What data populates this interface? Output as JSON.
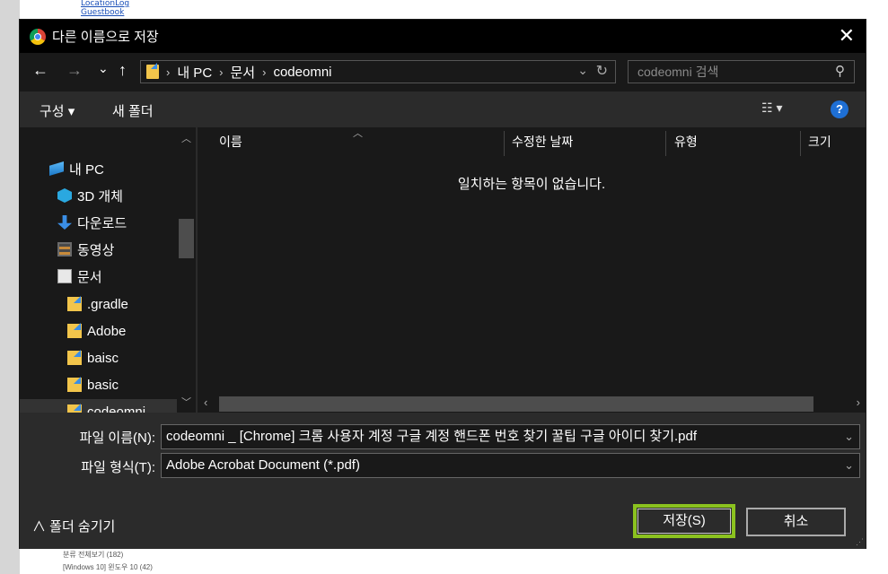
{
  "background_page": {
    "links": [
      "LocationLog",
      "Guestbook"
    ],
    "bottom_lines": [
      "분류 전체보기 (182)",
      "[Windows 10] 윈도우 10 (42)"
    ]
  },
  "dialog": {
    "title": "다른 이름으로 저장",
    "close_symbol": "✕",
    "nav": {
      "back_symbol": "←",
      "forward_symbol": "→",
      "recent_symbol": "⌄",
      "up_symbol": "↑"
    },
    "breadcrumb": [
      "내 PC",
      "문서",
      "codeomni"
    ],
    "search": {
      "placeholder": "codeomni 검색"
    },
    "toolbar": {
      "organize_label": "구성 ▾",
      "new_folder_label": "새 폴더",
      "view_symbol": "☷ ▾",
      "help_symbol": "?"
    },
    "tree": [
      {
        "label": "내 PC",
        "icon": "pc-icon"
      },
      {
        "label": "3D 개체",
        "icon": "3d-objects-icon"
      },
      {
        "label": "다운로드",
        "icon": "download-icon"
      },
      {
        "label": "동영상",
        "icon": "video-icon"
      },
      {
        "label": "문서",
        "icon": "document-icon"
      },
      {
        "label": ".gradle",
        "icon": "folder-icon"
      },
      {
        "label": "Adobe",
        "icon": "folder-icon"
      },
      {
        "label": "baisc",
        "icon": "folder-icon"
      },
      {
        "label": "basic",
        "icon": "folder-icon"
      },
      {
        "label": "codeomni",
        "icon": "folder-icon",
        "selected": true
      }
    ],
    "columns": [
      "이름",
      "수정한 날짜",
      "유형",
      "크기"
    ],
    "empty_message": "일치하는 항목이 없습니다.",
    "form": {
      "filename_label": "파일 이름(N):",
      "filename_value": "codeomni _ [Chrome] 크롬 사용자 계정 구글 계정 핸드폰 번호 찾기 꿀팁 구글 아이디 찾기.pdf",
      "filetype_label": "파일 형식(T):",
      "filetype_value": "Adobe Acrobat Document (*.pdf)"
    },
    "hide_folders_label": "∧ 폴더 숨기기",
    "save_label": "저장(S)",
    "cancel_label": "취소",
    "accent_color": "#8bc21f"
  }
}
